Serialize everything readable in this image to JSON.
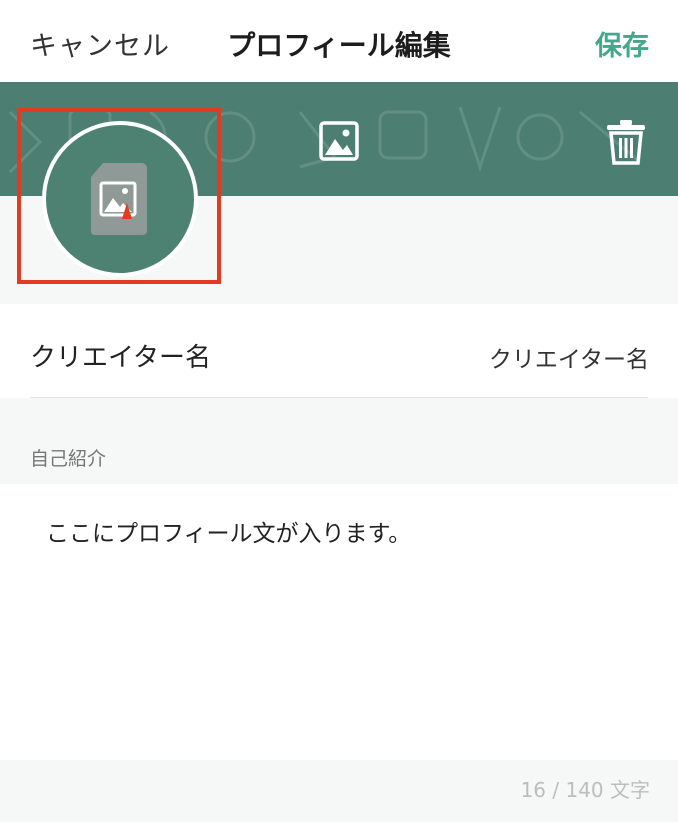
{
  "nav": {
    "cancel_label": "キャンセル",
    "title": "プロフィール編集",
    "save_label": "保存",
    "accent_color": "#41a98a"
  },
  "header": {
    "banner_color": "#4c7f71",
    "image_button_icon": "image-icon",
    "delete_button_icon": "trash-icon",
    "avatar_icon": "image-icon",
    "highlight_color": "#e23b22"
  },
  "profile": {
    "name_label": "クリエイター名",
    "name_value": "クリエイター名",
    "bio_section_label": "自己紹介",
    "bio_text": "ここにプロフィール文が入ります。",
    "char_count": "16 / 140 文字"
  }
}
